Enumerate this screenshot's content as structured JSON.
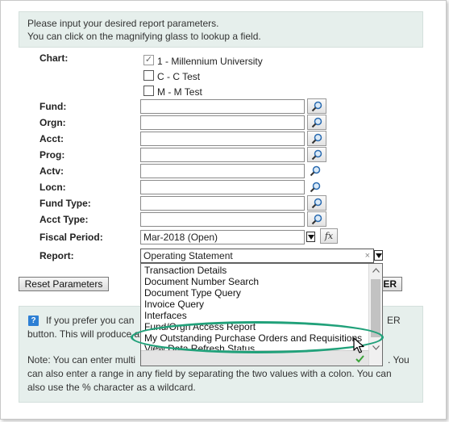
{
  "intro": {
    "line1": "Please input your desired report parameters.",
    "line2": "You can click on the magnifying glass to lookup a field."
  },
  "chart": {
    "label": "Chart:",
    "options": [
      {
        "label": "1 - Millennium University",
        "checked": true
      },
      {
        "label": "C - C Test",
        "checked": false
      },
      {
        "label": "M - M Test",
        "checked": false
      }
    ]
  },
  "fields": {
    "fund": {
      "label": "Fund:",
      "value": ""
    },
    "orgn": {
      "label": "Orgn:",
      "value": ""
    },
    "acct": {
      "label": "Acct:",
      "value": ""
    },
    "prog": {
      "label": "Prog:",
      "value": ""
    },
    "actv": {
      "label": "Actv:",
      "value": ""
    },
    "locn": {
      "label": "Locn:",
      "value": ""
    },
    "fund_type": {
      "label": "Fund Type:",
      "value": ""
    },
    "acct_type": {
      "label": "Acct Type:",
      "value": ""
    }
  },
  "fiscal_period": {
    "label": "Fiscal Period:",
    "value": "Mar-2018 (Open)",
    "fx": "fx"
  },
  "report": {
    "label": "Report:",
    "value": "Operating Statement",
    "clear": "×",
    "options": [
      "Transaction Details",
      "Document Number Search",
      "Document Type Query",
      "Invoice Query",
      "Interfaces",
      "Fund/Orgn Access Report",
      "My Outstanding Purchase Orders and Requisitions",
      "View Data Refresh Status"
    ],
    "highlighted": "My Outstanding Purchase Orders and Requisitions"
  },
  "buttons": {
    "reset": "Reset Parameters",
    "enter_partial": "ER"
  },
  "help": {
    "icon": "?",
    "line1_left": "If you prefer you can",
    "line1_right": "ER",
    "line2": "button. This will produce a",
    "line3_left": "Note: You can enter multi",
    "line3_right": ". You",
    "line4": "can also enter a range in any field by separating the two values with a colon. You can",
    "line5": "also use the % character as a wildcard."
  },
  "colors": {
    "panel": "#e6efec",
    "highlight_oval": "#21a17a",
    "check": "#3aa33a"
  }
}
